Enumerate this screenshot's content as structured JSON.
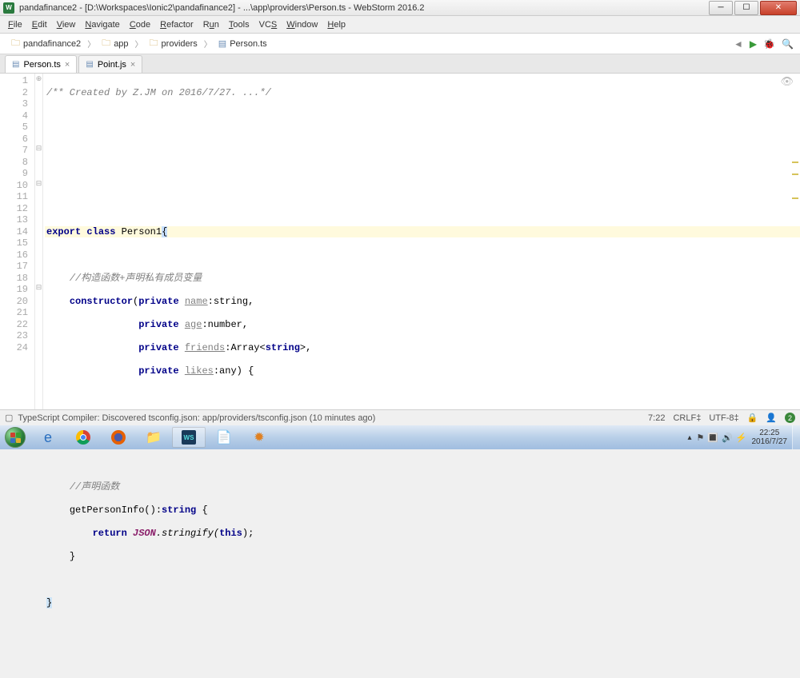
{
  "title": "pandafinance2 - [D:\\Workspaces\\Ionic2\\pandafinance2] - ...\\app\\providers\\Person.ts - WebStorm 2016.2",
  "menu": [
    "File",
    "Edit",
    "View",
    "Navigate",
    "Code",
    "Refactor",
    "Run",
    "Tools",
    "VCS",
    "Window",
    "Help"
  ],
  "breadcrumb": [
    {
      "icon": "folder",
      "label": "pandafinance2"
    },
    {
      "icon": "folder",
      "label": "app"
    },
    {
      "icon": "folder",
      "label": "providers"
    },
    {
      "icon": "file",
      "label": "Person.ts"
    }
  ],
  "tabs": [
    {
      "label": "Person.ts",
      "active": true
    },
    {
      "label": "Point.js",
      "active": false
    }
  ],
  "code": {
    "lines": [
      1,
      2,
      3,
      4,
      5,
      6,
      7,
      8,
      9,
      10,
      11,
      12,
      13,
      14,
      15,
      16,
      17,
      18,
      19,
      20,
      21,
      22,
      23,
      24
    ],
    "l1_comment": "/** Created by Z.JM on 2016/7/27. ...*/",
    "l7_export": "export",
    "l7_class": "class",
    "l7_name": "Person1",
    "l7_brace": "{",
    "l9_comment": "//构造函数+声明私有成员变量",
    "l10_ctor": "constructor",
    "l10_priv": "private",
    "l10_name": "name",
    "l10_type": ":string,",
    "l11_priv": "private",
    "l11_name": "age",
    "l11_type": ":number,",
    "l12_priv": "private",
    "l12_name": "friends",
    "l12_type": ":Array<",
    "l12_str": "string",
    "l12_end": ">,",
    "l13_priv": "private",
    "l13_name": "likes",
    "l13_type": ":any) {",
    "l16_close": "}",
    "l18_comment": "//声明函数",
    "l19_fn": "getPersonInfo():",
    "l19_str": "string",
    "l19_brace": " {",
    "l20_return": "return",
    "l20_json": "JSON",
    "l20_strf": ".stringify(",
    "l20_this": "this",
    "l20_end": ");",
    "l21_close": "}",
    "l23_close": "}"
  },
  "status": {
    "message": "TypeScript Compiler: Discovered tsconfig.json: app/providers/tsconfig.json (10 minutes ago)",
    "pos": "7:22",
    "eol": "CRLF‡",
    "enc": "UTF-8‡",
    "badge": "2"
  },
  "tray": {
    "time": "22:25",
    "date": "2016/7/27"
  }
}
